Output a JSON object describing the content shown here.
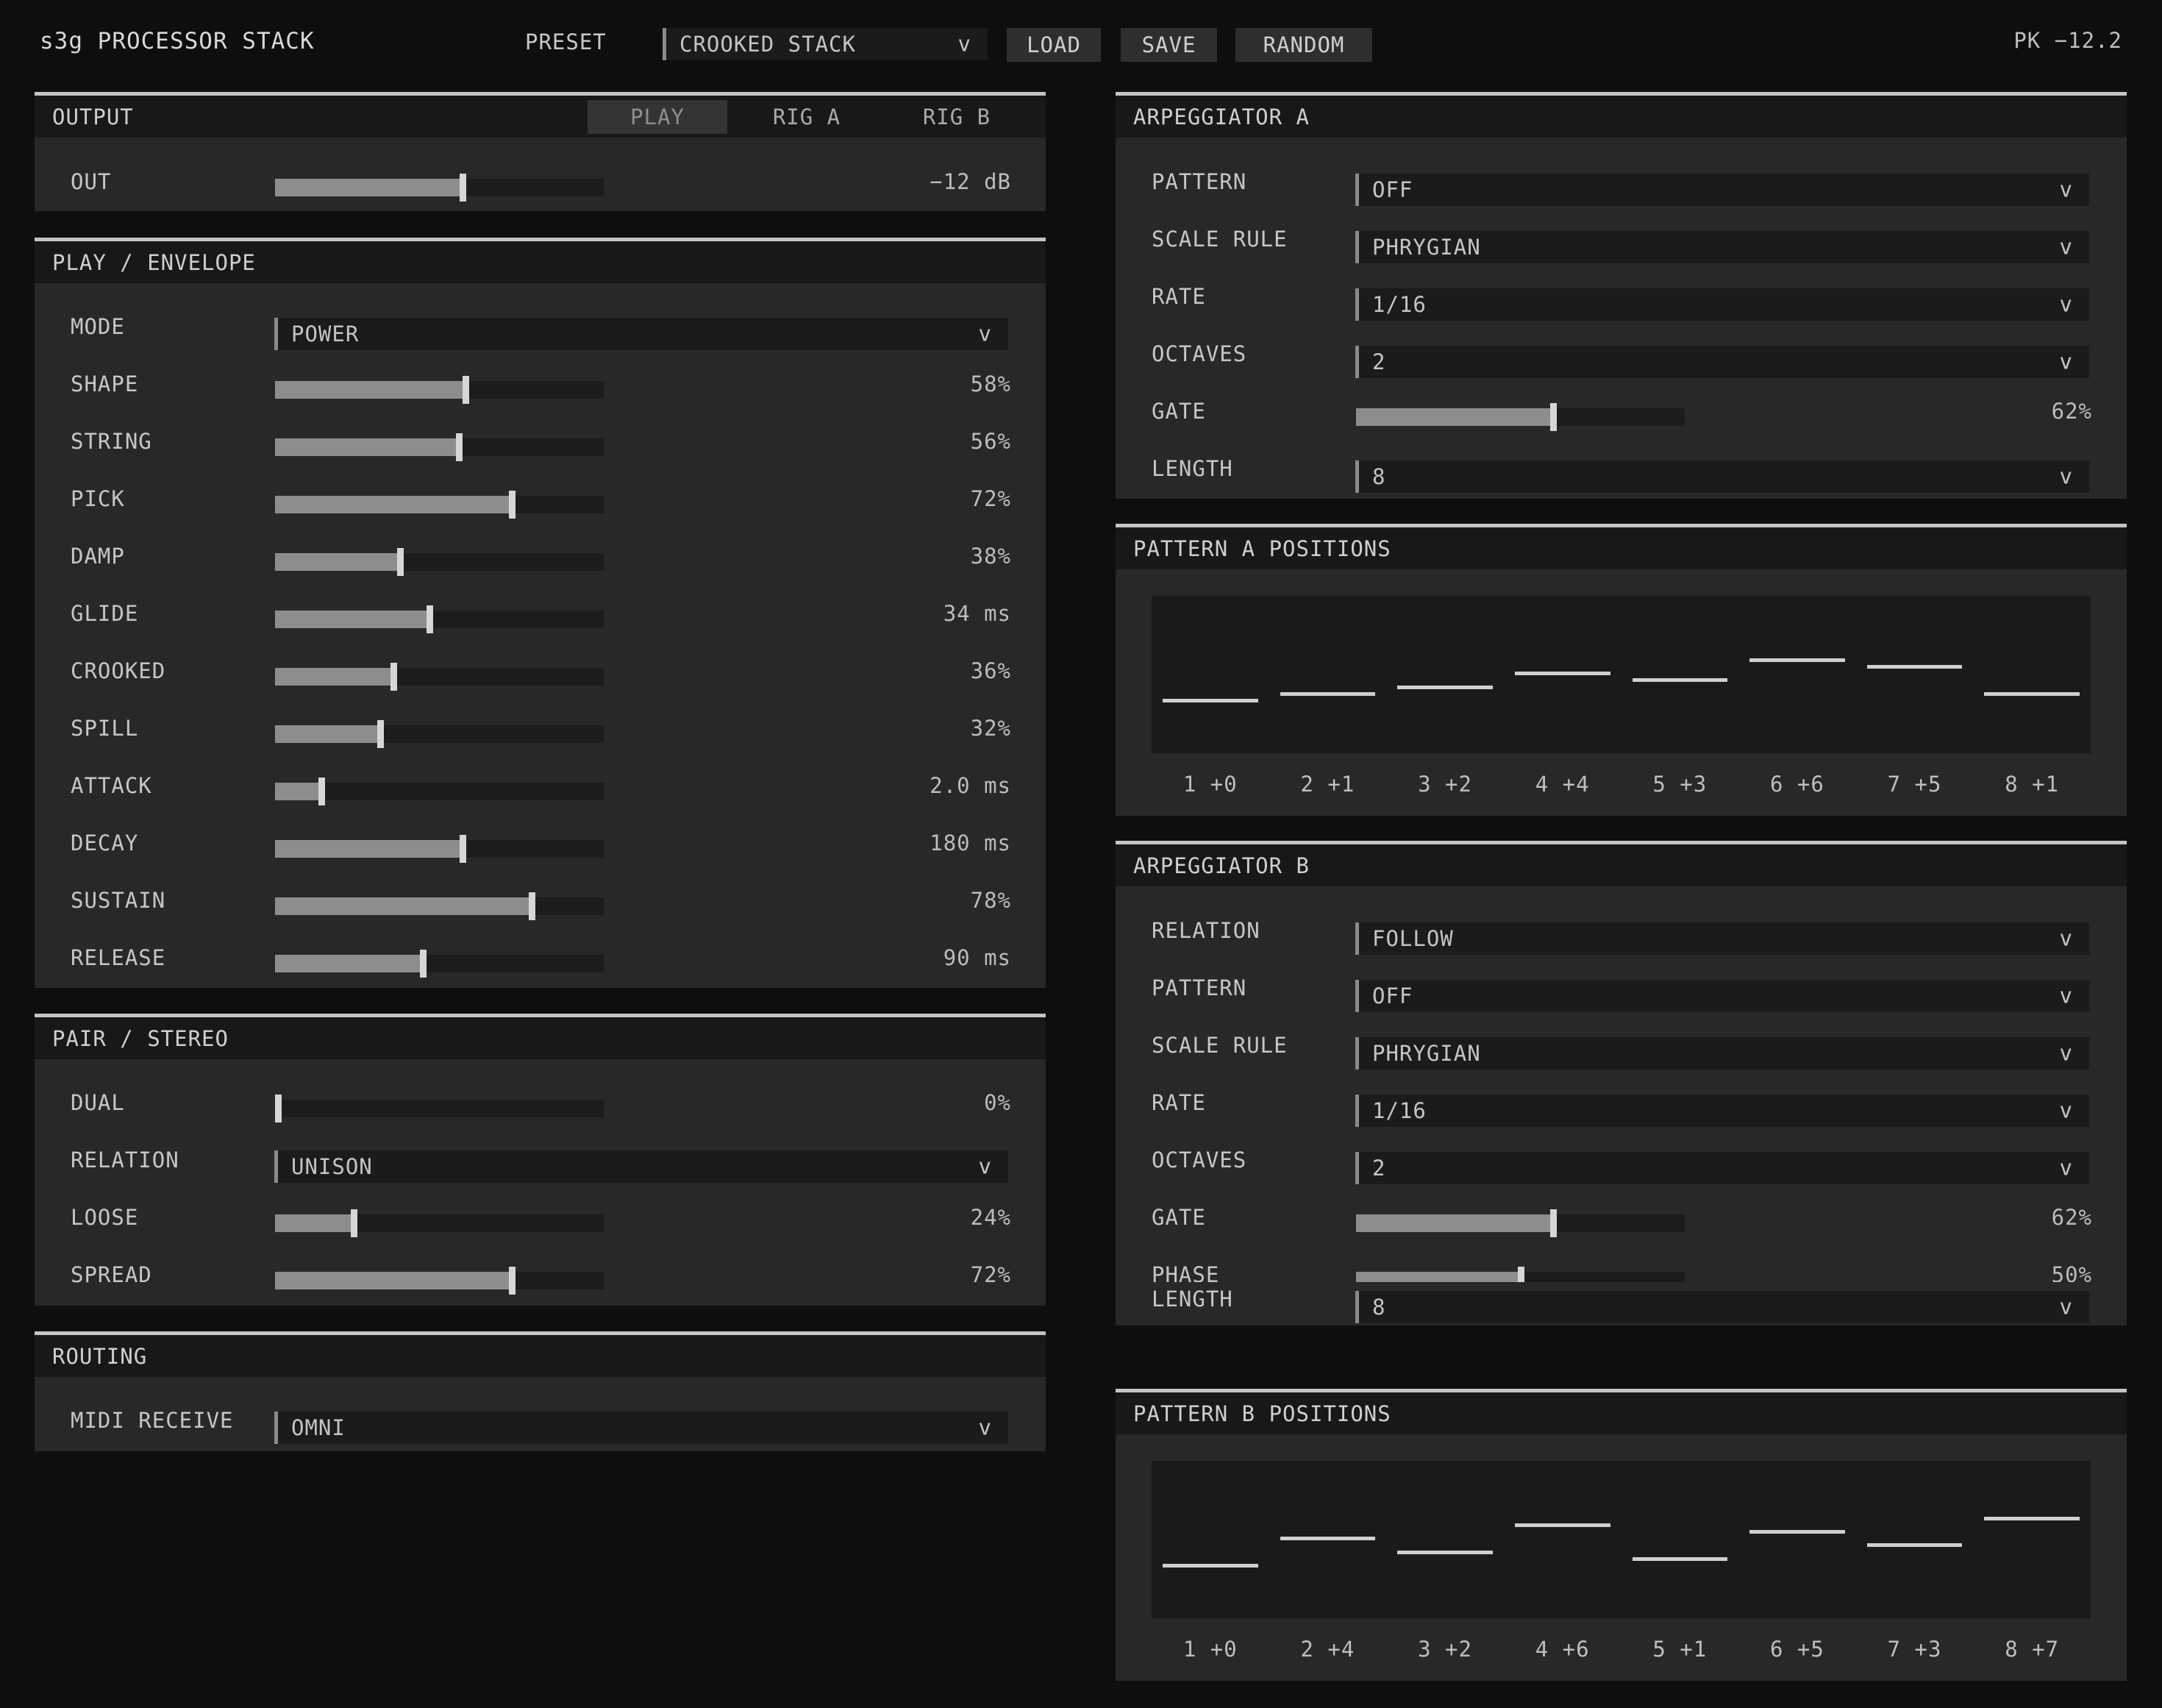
{
  "header": {
    "title": "s3g PROCESSOR STACK",
    "preset_label": "PRESET",
    "preset_value": "CROOKED STACK",
    "load": "LOAD",
    "save": "SAVE",
    "random": "RANDOM",
    "peak": "PK −12.2"
  },
  "chev": "v",
  "output": {
    "title": "OUTPUT",
    "tabs": [
      "PLAY",
      "RIG A",
      "RIG B"
    ],
    "active_tab": 0,
    "out": {
      "label": "OUT",
      "value": "−12 dB",
      "level": 0.57
    }
  },
  "play": {
    "title": "PLAY / ENVELOPE",
    "mode": {
      "label": "MODE",
      "value": "POWER"
    },
    "sliders": [
      {
        "label": "SHAPE",
        "value": "58%",
        "level": 0.58
      },
      {
        "label": "STRING",
        "value": "56%",
        "level": 0.56
      },
      {
        "label": "PICK",
        "value": "72%",
        "level": 0.72
      },
      {
        "label": "DAMP",
        "value": "38%",
        "level": 0.38
      },
      {
        "label": "GLIDE",
        "value": "34 ms",
        "level": 0.47
      },
      {
        "label": "CROOKED",
        "value": "36%",
        "level": 0.36
      },
      {
        "label": "SPILL",
        "value": "32%",
        "level": 0.32
      },
      {
        "label": "ATTACK",
        "value": "2.0 ms",
        "level": 0.14
      },
      {
        "label": "DECAY",
        "value": "180 ms",
        "level": 0.57
      },
      {
        "label": "SUSTAIN",
        "value": "78%",
        "level": 0.78
      },
      {
        "label": "RELEASE",
        "value": "90 ms",
        "level": 0.45
      }
    ]
  },
  "pair": {
    "title": "PAIR / STEREO",
    "dual": {
      "label": "DUAL",
      "value": "0%",
      "level": 0.0
    },
    "relation": {
      "label": "RELATION",
      "value": "UNISON"
    },
    "loose": {
      "label": "LOOSE",
      "value": "24%",
      "level": 0.24
    },
    "spread": {
      "label": "SPREAD",
      "value": "72%",
      "level": 0.72
    }
  },
  "routing": {
    "title": "ROUTING",
    "midi": {
      "label": "MIDI RECEIVE",
      "value": "OMNI"
    }
  },
  "arp_a": {
    "title": "ARPEGGIATOR A",
    "pattern": {
      "label": "PATTERN",
      "value": "OFF"
    },
    "scale": {
      "label": "SCALE RULE",
      "value": "PHRYGIAN"
    },
    "rate": {
      "label": "RATE",
      "value": "1/16"
    },
    "octaves": {
      "label": "OCTAVES",
      "value": "2"
    },
    "gate": {
      "label": "GATE",
      "value": "62%",
      "level": 0.6
    },
    "length": {
      "label": "LENGTH",
      "value": "8"
    }
  },
  "pattern_a": {
    "title": "PATTERN A POSITIONS",
    "steps": [
      {
        "label": "1 +0",
        "offset": 0
      },
      {
        "label": "2 +1",
        "offset": 1
      },
      {
        "label": "3 +2",
        "offset": 2
      },
      {
        "label": "4 +4",
        "offset": 4
      },
      {
        "label": "5 +3",
        "offset": 3
      },
      {
        "label": "6 +6",
        "offset": 6
      },
      {
        "label": "7 +5",
        "offset": 5
      },
      {
        "label": "8 +1",
        "offset": 1
      }
    ]
  },
  "arp_b": {
    "title": "ARPEGGIATOR B",
    "relation": {
      "label": "RELATION",
      "value": "FOLLOW"
    },
    "pattern": {
      "label": "PATTERN",
      "value": "OFF"
    },
    "scale": {
      "label": "SCALE RULE",
      "value": "PHRYGIAN"
    },
    "rate": {
      "label": "RATE",
      "value": "1/16"
    },
    "octaves": {
      "label": "OCTAVES",
      "value": "2"
    },
    "gate": {
      "label": "GATE",
      "value": "62%",
      "level": 0.6
    },
    "phase": {
      "label": "PHASE",
      "value": "50%",
      "level": 0.5
    },
    "length": {
      "label": "LENGTH",
      "value": "8"
    }
  },
  "pattern_b": {
    "title": "PATTERN B POSITIONS",
    "steps": [
      {
        "label": "1 +0",
        "offset": 0
      },
      {
        "label": "2 +4",
        "offset": 4
      },
      {
        "label": "3 +2",
        "offset": 2
      },
      {
        "label": "4 +6",
        "offset": 6
      },
      {
        "label": "5 +1",
        "offset": 1
      },
      {
        "label": "6 +5",
        "offset": 5
      },
      {
        "label": "7 +3",
        "offset": 3
      },
      {
        "label": "8 +7",
        "offset": 7
      }
    ]
  }
}
